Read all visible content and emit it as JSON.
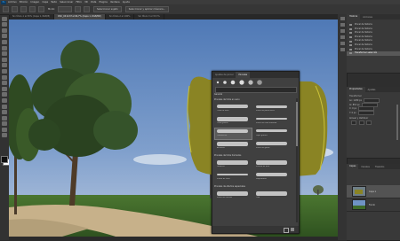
{
  "app": {
    "title": "Adobe Photoshop"
  },
  "menu": [
    "Archivo",
    "Edición",
    "Imagen",
    "Capa",
    "Texto",
    "Seleccionar",
    "Filtro",
    "3D",
    "Vista",
    "Plugins",
    "Ventana",
    "Ayuda"
  ],
  "options": {
    "mode_label": "Modo:",
    "select_subject_label": "Seleccionar sujeto",
    "select_and_mask_label": "Seleccionar y aplicar máscara..."
  },
  "tabs": [
    {
      "label": "Sin título-1 al 50% (Capa 1, RGB/8)"
    },
    {
      "label": "DSC_0412.tif al 66,7% (Capa 1, RGB/8#)"
    },
    {
      "label": "Sin título-2 al 100%"
    },
    {
      "label": "Sin título-3 al 33,3%"
    }
  ],
  "brushes_panel": {
    "tabs": [
      "Ajustes de pincel",
      "Pinceles"
    ],
    "folders": [
      "General",
      "Pinceles de tinta en seco",
      "Pinceles de tinta húmedos",
      "Pinceles de efectos especiales"
    ],
    "presets": [
      "Tinta en seco",
      "Pincel de punta seca",
      "Tinta gruesa",
      "Pincel de tinta húmeda",
      "Carboncillo",
      "Lápiz gráfico",
      "Acuarela",
      "Pincel de goma",
      "Gouache",
      "Pintura de óleo",
      "Pluma de tinta",
      "Salpicadura",
      "Pincel de efectos",
      "Tiza"
    ]
  },
  "history_panel": {
    "tabs": [
      "Historia",
      "Acciones"
    ],
    "items": [
      "Pincel de historia",
      "Pincel de historia",
      "Pincel de historia",
      "Pincel de historia",
      "Pincel de historia",
      "Pincel de historia",
      "Pincel de historia",
      "Transformar selección"
    ]
  },
  "properties_panel": {
    "tabs": [
      "Propiedades",
      "Ajustes"
    ],
    "section": "Transformar",
    "align_label": "Alinear y distribuir",
    "fields": [
      "An: 1280 px",
      "Al: 853 px",
      "X: 0 px",
      "Y: 0 px"
    ]
  },
  "layers_panel": {
    "tabs": [
      "Capas",
      "Canales",
      "Trazados"
    ],
    "layers": [
      {
        "name": "Capa 1"
      },
      {
        "name": "Fondo"
      }
    ]
  },
  "colors": {
    "brush_paint": "#8a8424",
    "sky": "#6f93c4",
    "grass": "#3f6a2a",
    "path": "#c9b48a"
  }
}
